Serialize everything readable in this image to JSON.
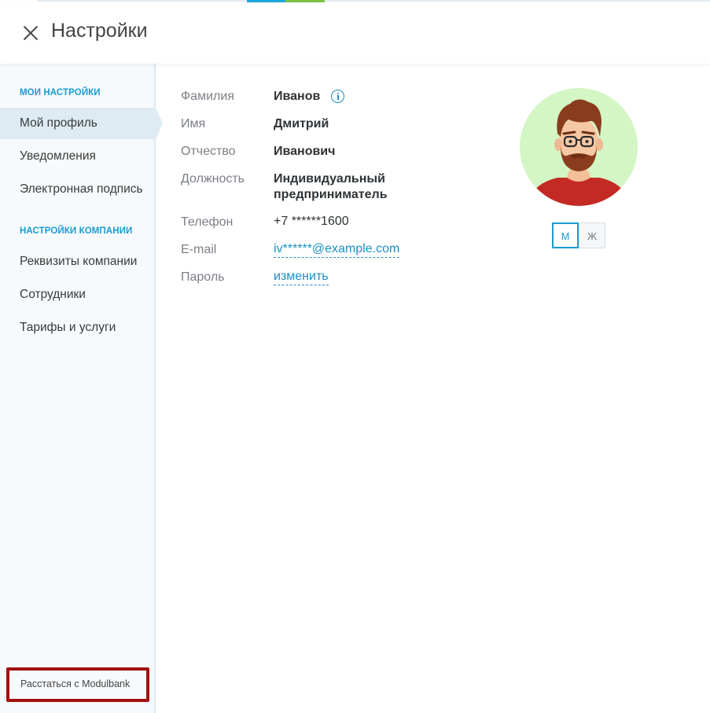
{
  "header": {
    "title": "Настройки"
  },
  "sidebar": {
    "section_my": "МОИ НАСТРОЙКИ",
    "my_items": [
      {
        "label": "Мой профиль",
        "active": true
      },
      {
        "label": "Уведомления",
        "active": false
      },
      {
        "label": "Электронная подпись",
        "active": false
      }
    ],
    "section_company": "НАСТРОЙКИ КОМПАНИИ",
    "company_items": [
      {
        "label": "Реквизиты компании"
      },
      {
        "label": "Сотрудники"
      },
      {
        "label": "Тарифы и услуги"
      }
    ],
    "leave_label": "Расстаться с Modulbank"
  },
  "profile": {
    "surname": {
      "label": "Фамилия",
      "value": "Иванов"
    },
    "name": {
      "label": "Имя",
      "value": "Дмитрий"
    },
    "patronymic": {
      "label": "Отчество",
      "value": "Иванович"
    },
    "position": {
      "label": "Должность",
      "value_line1": "Индивидуальный",
      "value_line2": "предприниматель"
    },
    "phone": {
      "label": "Телефон",
      "value": "+7 ******1600"
    },
    "email": {
      "label": "E-mail",
      "value": "iv******@example.com"
    },
    "password": {
      "label": "Пароль",
      "action": "изменить"
    }
  },
  "gender": {
    "male": "М",
    "female": "Ж",
    "selected": "М"
  },
  "colors": {
    "accent": "#1b9bd1",
    "link": "#1b8fc4",
    "leave_border": "#a11010",
    "avatar_bg": "#d3f6c4"
  },
  "icons": {
    "close": "close-icon",
    "info": "info-icon"
  }
}
